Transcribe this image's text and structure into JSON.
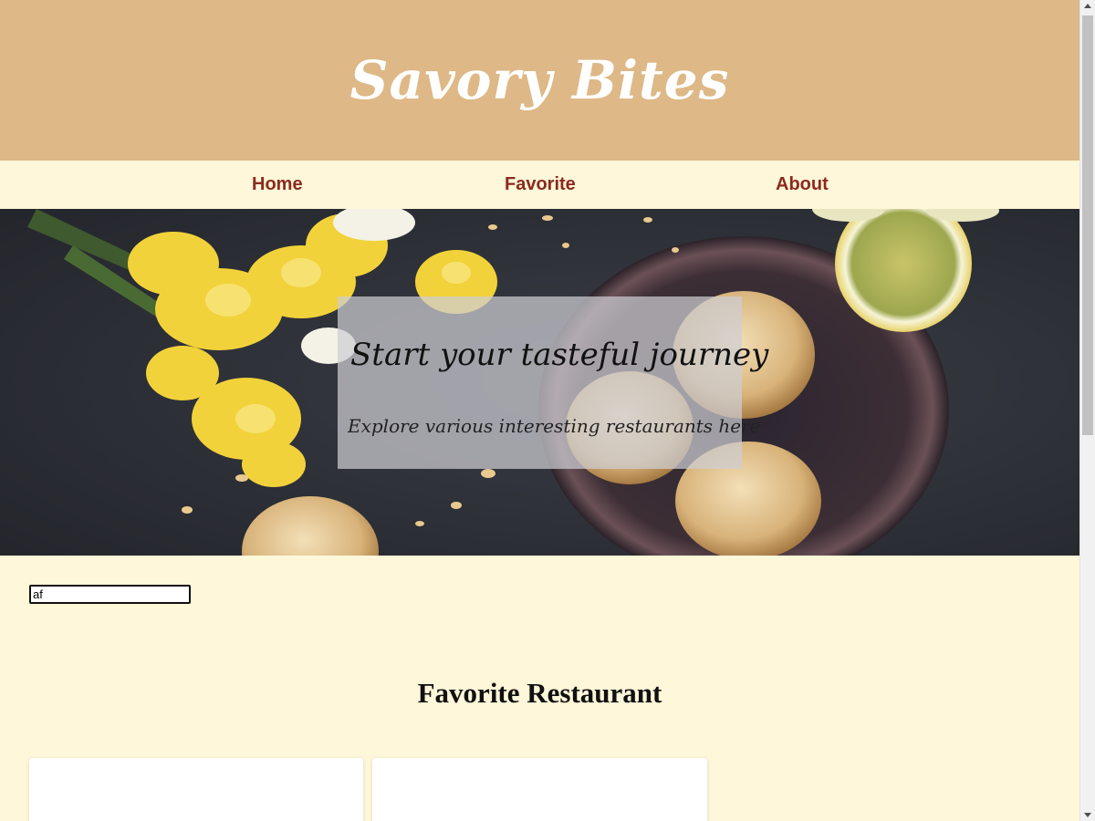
{
  "header": {
    "title": "Savory Bites"
  },
  "nav": {
    "items": [
      {
        "label": "Home"
      },
      {
        "label": "Favorite"
      },
      {
        "label": "About"
      }
    ]
  },
  "hero": {
    "title": "Start your tasteful journey",
    "subtitle": "Explore various interesting restaurants here"
  },
  "search": {
    "value": "af"
  },
  "main": {
    "section_title": "Favorite Restaurant"
  },
  "colors": {
    "header_bg": "#deb887",
    "page_bg": "#fef7d9",
    "nav_link": "#8b2a1f",
    "hero_bg": "#2c2f36"
  }
}
